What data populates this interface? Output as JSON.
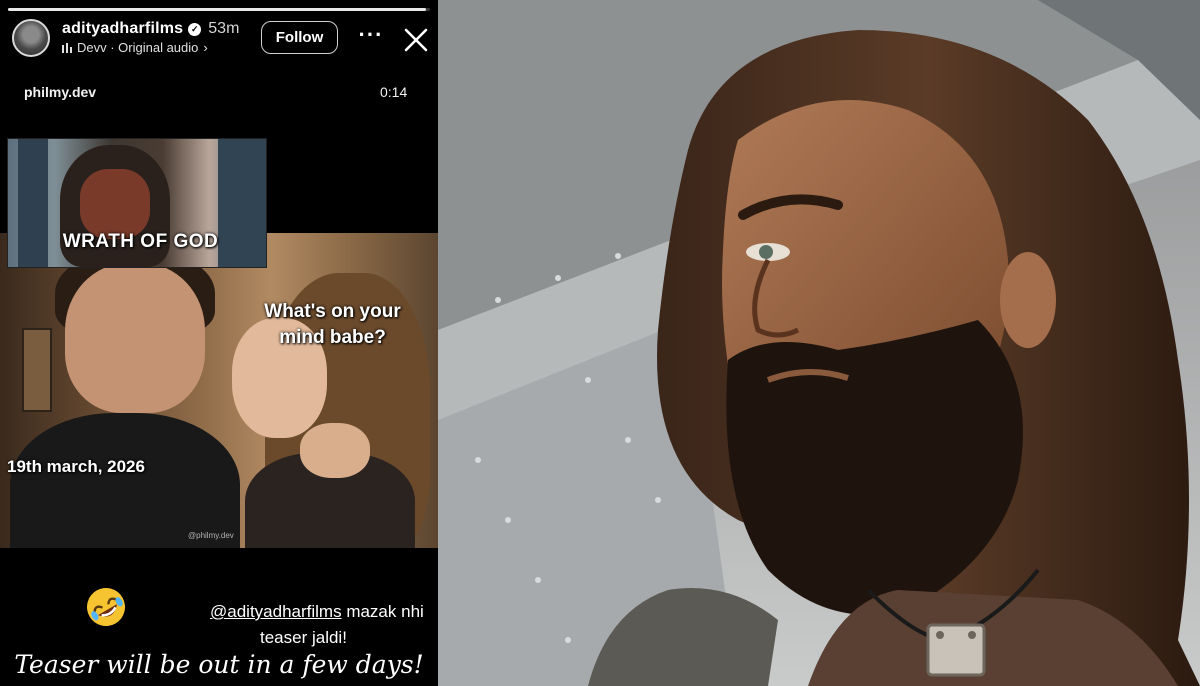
{
  "story": {
    "progress_fraction": 0.99,
    "header": {
      "username": "adityadharfilms",
      "verified_icon": "verified-badge-icon",
      "time_ago": "53m",
      "audio_label": "Devv · Original audio",
      "audio_chevron": "›",
      "follow_label": "Follow",
      "more_icon": "more-icon",
      "more_glyph": "···",
      "close_icon": "close-icon"
    },
    "repost": {
      "handle": "philmy.dev",
      "duration": "0:14"
    },
    "meme": {
      "inset_text": "WRATH OF GOD",
      "question_line1": "What's on your",
      "question_line2": "mind babe?",
      "date_text": "19th march, 2026",
      "watermark": "@philmy.dev"
    },
    "caption": {
      "emoji_icon": "rolling-on-floor-laughing-emoji",
      "mention": "@adityadharfilms",
      "line1_rest": " mazak nhi",
      "line2": "teaser jaldi!",
      "teaser_line": "Teaser will be out in a few days!"
    }
  },
  "photo": {
    "subject": "bearded-man-portrait"
  },
  "colors": {
    "background": "#000000",
    "text": "#ffffff",
    "follow_border": "#cfcfcf"
  }
}
